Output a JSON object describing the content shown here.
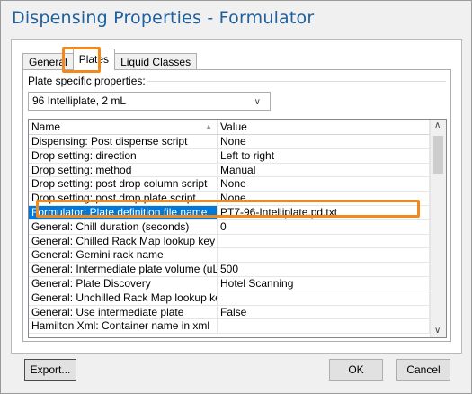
{
  "window": {
    "title": "Dispensing Properties - Formulator"
  },
  "tabs": [
    {
      "label": "General",
      "active": false
    },
    {
      "label": "Plates",
      "active": true
    },
    {
      "label": "Liquid Classes",
      "active": false
    }
  ],
  "plates": {
    "group_label": "Plate specific properties:",
    "selected_plate": "96 Intelliplate, 2 mL"
  },
  "grid": {
    "columns": {
      "name": "Name",
      "value": "Value"
    },
    "rows": [
      {
        "name": "Dispensing: Post dispense script",
        "value": "None"
      },
      {
        "name": "Drop setting: direction",
        "value": "Left to right"
      },
      {
        "name": "Drop setting: method",
        "value": "Manual"
      },
      {
        "name": "Drop setting: post drop column script",
        "value": "None"
      },
      {
        "name": "Drop setting: post drop plate script",
        "value": "None"
      },
      {
        "name": "Formulator: Plate definition file name",
        "value": "PT7-96-Intelliplate.pd.txt",
        "selected": true
      },
      {
        "name": "General: Chill duration (seconds)",
        "value": "0"
      },
      {
        "name": "General: Chilled Rack Map lookup key",
        "value": ""
      },
      {
        "name": "General: Gemini rack name",
        "value": ""
      },
      {
        "name": "General: Intermediate plate volume (uL)",
        "value": "500"
      },
      {
        "name": "General: Plate Discovery",
        "value": "Hotel Scanning"
      },
      {
        "name": "General: Unchilled Rack Map lookup key",
        "value": ""
      },
      {
        "name": "General: Use intermediate plate",
        "value": "False"
      },
      {
        "name": "Hamilton Xml: Container name in xml",
        "value": ""
      }
    ]
  },
  "buttons": {
    "export": "Export...",
    "ok": "OK",
    "cancel": "Cancel"
  },
  "colors": {
    "title": "#1f5f9e",
    "highlight": "#f08a1e",
    "selection": "#0078d7"
  }
}
